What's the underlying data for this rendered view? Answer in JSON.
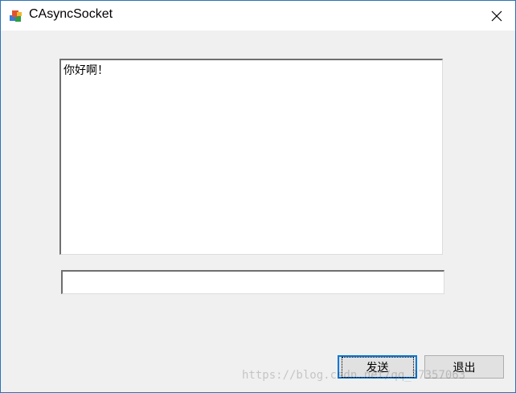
{
  "window": {
    "title": "CAsyncSocket",
    "icons": {
      "app": "mfc-app-icon",
      "close": "close-icon"
    }
  },
  "output_box": {
    "text": "你好啊！"
  },
  "input_box": {
    "value": ""
  },
  "buttons": {
    "send": "发送",
    "quit": "退出"
  },
  "watermark": "https://blog.csdn.net/qq_37357063"
}
